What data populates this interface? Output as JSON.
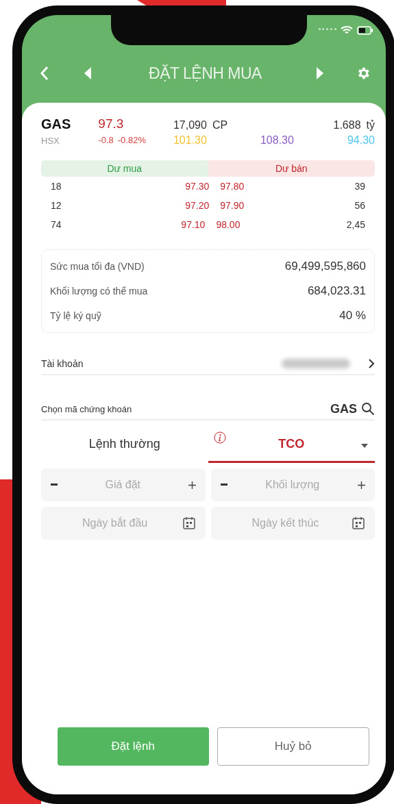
{
  "header": {
    "title": "ĐẶT LỆNH MUA"
  },
  "quote": {
    "symbol": "GAS",
    "exchange": "HSX",
    "price": "97.3",
    "change": "-0.8",
    "change_pct": "-0.82%",
    "volume": "17,090",
    "volume_unit": "CP",
    "value": "1.688",
    "value_unit": "tỷ",
    "price_levels": [
      {
        "value": "101.30",
        "color": "#f2c233"
      },
      {
        "value": "108.30",
        "color": "#8a5cc4"
      },
      {
        "value": "94.30",
        "color": "#4fc3ec"
      }
    ]
  },
  "order_book": {
    "buy_label": "Dư mua",
    "sell_label": "Dư bán",
    "rows": [
      {
        "buy_volume": "18",
        "buy_price": "97.30",
        "sell_price": "97.80",
        "sell_volume": "39"
      },
      {
        "buy_volume": "12",
        "buy_price": "97.20",
        "sell_price": "97.90",
        "sell_volume": "56"
      },
      {
        "buy_volume": "74",
        "buy_price": "97.10",
        "sell_price": "98.00",
        "sell_volume": "2,45"
      }
    ]
  },
  "buying_power": [
    {
      "label": "Sức mua tối đa (VND)",
      "value": "69,499,595,860"
    },
    {
      "label": "Khối lượng có thể mua",
      "value": "684,023.31"
    },
    {
      "label": "Tỷ lệ ký quỹ",
      "value": "40 %"
    }
  ],
  "account": {
    "label": "Tài khoản"
  },
  "symbol_field": {
    "label": "Chọn mã chứng khoán",
    "value": "GAS"
  },
  "order_tabs": [
    {
      "label": "Lệnh thường",
      "selected": false
    },
    {
      "label": "TCO",
      "selected": true
    }
  ],
  "fields": [
    {
      "kind": "stepper",
      "placeholder": "Giá đặt"
    },
    {
      "kind": "stepper",
      "placeholder": "Khối lượng"
    },
    {
      "kind": "date",
      "placeholder": "Ngày bắt đầu"
    },
    {
      "kind": "date",
      "placeholder": "Ngày kết thúc"
    }
  ],
  "buttons": [
    {
      "label": "Đặt lệnh",
      "kind": "primary"
    },
    {
      "label": "Huỷ bỏ",
      "kind": "secondary"
    }
  ]
}
